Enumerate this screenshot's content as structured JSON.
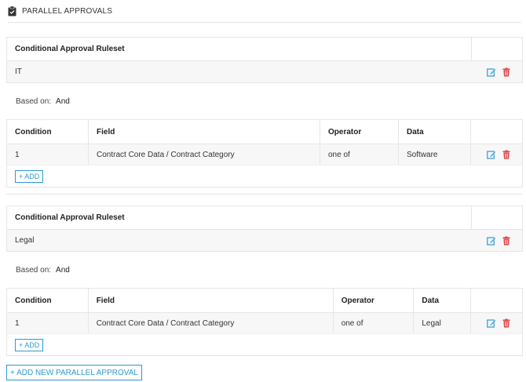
{
  "header": {
    "title": "PARALLEL APPROVALS",
    "icon": "clipboard-check-icon"
  },
  "colors": {
    "accent": "#2b9bd1",
    "delete": "#e03a3a",
    "edit": "#2b9bd1"
  },
  "groups": [
    {
      "ruleset_header": "Conditional Approval Ruleset",
      "ruleset_name": "IT",
      "based_label": "Based on:",
      "based_value": "And",
      "columns": [
        "Condition",
        "Field",
        "Operator",
        "Data"
      ],
      "rows": [
        {
          "condition": "1",
          "field": "Contract Core Data / Contract Category",
          "operator": "one of",
          "data": "Software"
        }
      ],
      "add_label": "+ ADD"
    },
    {
      "ruleset_header": "Conditional Approval Ruleset",
      "ruleset_name": "Legal",
      "based_label": "Based on:",
      "based_value": "And",
      "columns": [
        "Condition",
        "Field",
        "Operator",
        "Data"
      ],
      "rows": [
        {
          "condition": "1",
          "field": "Contract Core Data / Contract Category",
          "operator": "one of",
          "data": "Legal"
        }
      ],
      "add_label": "+ ADD"
    }
  ],
  "add_new_label": "+ ADD NEW PARALLEL APPROVAL"
}
